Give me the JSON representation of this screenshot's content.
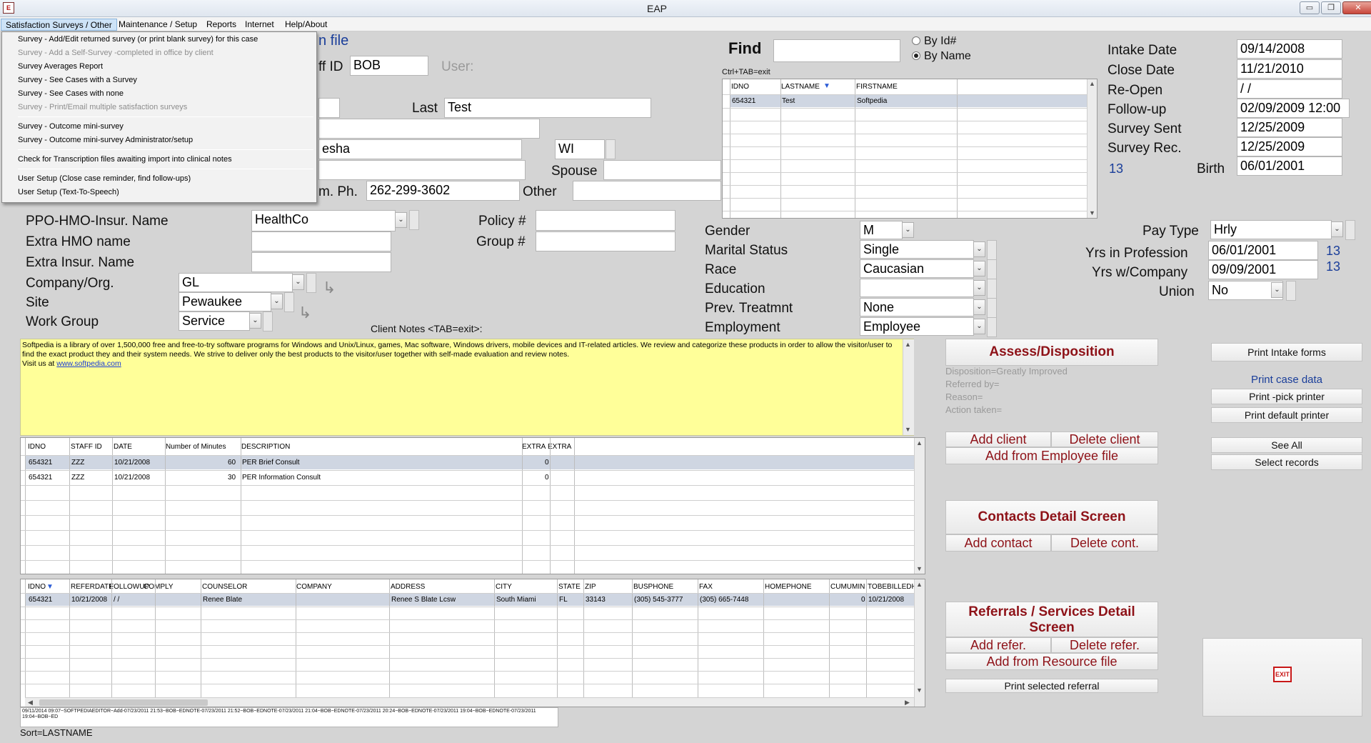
{
  "window": {
    "title": "EAP",
    "minimize": "▭",
    "restore": "❐",
    "close": "✕"
  },
  "menu": {
    "items": [
      "Satisfaction Surveys / Other",
      "Maintenance / Setup",
      "Reports",
      "Internet",
      "Help/About"
    ]
  },
  "dropdown": {
    "items": [
      {
        "label": "Survey - Add/Edit returned survey (or print blank survey) for this case",
        "disabled": false
      },
      {
        "label": "Survey - Add a Self-Survey -completed in office by client",
        "disabled": true
      },
      {
        "label": "Survey Averages Report",
        "disabled": false
      },
      {
        "label": "Survey - See Cases with a Survey",
        "disabled": false
      },
      {
        "label": "Survey - See Cases with none",
        "disabled": false
      },
      {
        "label": "Survey - Print/Email multiple satisfaction surveys",
        "disabled": true
      },
      {
        "label": "Survey - Outcome mini-survey",
        "disabled": false
      },
      {
        "label": "Survey - Outcome mini-survey Administrator/setup",
        "disabled": false
      },
      {
        "label": "Check for Transcription files awaiting import into clinical notes",
        "disabled": false
      },
      {
        "label": "User Setup  (Close case reminder, find follow-ups)",
        "disabled": false
      },
      {
        "label": "User Setup (Text-To-Speech)",
        "disabled": false
      }
    ]
  },
  "header": {
    "file_label": "n file",
    "staff_id_label": "ff ID",
    "staff_id": "BOB",
    "user_label": "User:",
    "last_label": "Last",
    "last_value": "Test",
    "city_partial": "esha",
    "state": "WI",
    "spouse_label": "Spouse",
    "home_phone_label": "m. Ph.",
    "home_phone": "262-299-3602",
    "other_label": "Other"
  },
  "find": {
    "label": "Find",
    "value": "",
    "hint": "Ctrl+TAB=exit",
    "radio_id": "By Id#",
    "radio_name": "By Name",
    "columns": [
      "IDNO",
      "LASTNAME",
      "FIRSTNAME"
    ],
    "sort_icon": "▼",
    "rows": [
      [
        "654321",
        "Test",
        "Softpedia"
      ]
    ]
  },
  "dates": {
    "intake_label": "Intake Date",
    "intake": "09/14/2008",
    "close_label": "Close Date",
    "close": "11/21/2010",
    "reopen_label": "Re-Open",
    "reopen": " /  /",
    "followup_label": "Follow-up",
    "followup": "02/09/2009 12:00",
    "survey_sent_label": "Survey Sent",
    "survey_sent": "12/25/2009",
    "survey_rec_label": "Survey Rec.",
    "survey_rec": "12/25/2009",
    "age": "13",
    "birth_label": "Birth",
    "birth": "06/01/2001"
  },
  "insurance": {
    "ppo_label": "PPO-HMO-Insur. Name",
    "ppo": "HealthCo",
    "extra_hmo_label": "Extra HMO name",
    "extra_hmo": "",
    "extra_ins_label": "Extra Insur. Name",
    "extra_ins": "",
    "policy_label": "Policy #",
    "policy": "",
    "group_label": "Group #",
    "group": ""
  },
  "company": {
    "company_label": "Company/Org.",
    "company": "GL",
    "site_label": "Site",
    "site": "Pewaukee",
    "workgroup_label": "Work Group",
    "workgroup": "Service"
  },
  "demographics": {
    "gender_label": "Gender",
    "gender": "M",
    "marital_label": "Marital Status",
    "marital": "Single",
    "race_label": "Race",
    "race": "Caucasian",
    "education_label": "Education",
    "education": "",
    "prev_label": "Prev. Treatmnt",
    "prev": "None",
    "employment_label": "Employment",
    "employment": "Employee"
  },
  "employment": {
    "pay_type_label": "Pay Type",
    "pay_type": "Hrly",
    "yrs_prof_label": "Yrs in Profession",
    "yrs_prof": "06/01/2001",
    "yrs_prof_num": "13",
    "yrs_comp_label": "Yrs w/Company",
    "yrs_comp": "09/09/2001",
    "yrs_comp_num": "13",
    "union_label": "Union",
    "union": "No"
  },
  "notes": {
    "label": "Client Notes <TAB=exit>:",
    "text": "Softpedia is a library of over 1,500,000 free and free-to-try software programs for Windows and Unix/Linux, games,  Mac software, Windows drivers, mobile devices and IT-related articles. We review and categorize these products in order to allow the visitor/user to find the exact product they and  their system needs.  We strive to deliver only the best products to the visitor/user together with self-made evaluation and review  notes.",
    "visit": "Visit us at ",
    "link": "www.softpedia.com"
  },
  "services": {
    "columns": [
      "IDNO",
      "STAFF ID",
      "DATE",
      "Number of Minutes",
      "DESCRIPTION",
      "EXTRA",
      "EXTRA"
    ],
    "rows": [
      [
        "654321",
        "ZZZ",
        "10/21/2008",
        "60",
        "PER Brief Consult",
        "0"
      ],
      [
        "654321",
        "ZZZ",
        "10/21/2008",
        "30",
        "PER Information Consult",
        "0"
      ]
    ]
  },
  "referrals": {
    "columns": [
      "IDNO",
      "REFERDATE",
      "FOLLOWUP",
      "COMPLY",
      "COUNSELOR",
      "COMPANY",
      "ADDRESS",
      "CITY",
      "STATE",
      "ZIP",
      "BUSPHONE",
      "FAX",
      "HOMEPHONE",
      "CUMUMIN",
      "TOBEBILLEDH"
    ],
    "sort_icon": "▼",
    "rows": [
      [
        "654321",
        "10/21/2008",
        " /  /",
        "",
        "Renee Blate",
        "",
        "Renee S Blate Lcsw",
        "South Miami",
        "FL",
        "33143",
        "(305) 545-3777",
        "(305) 665-7448",
        "",
        "0",
        "10/21/2008"
      ]
    ]
  },
  "log": {
    "text": "09/11/2014 09:07~SOFTPEDIAEDITOR~Add-07/23/2011 21:53~BOB~EDNOTE-07/23/2011 21:52~BOB~EDNOTE-07/23/2011 21:04~BOB~EDNOTE-07/23/2011 20:24~BOB~EDNOTE-07/23/2011 19:04~BOB~EDNOTE-07/23/2011 19:04~BOB~ED",
    "sort": "Sort=LASTNAME"
  },
  "actions": {
    "assess": "Assess/Disposition",
    "disposition": "Disposition=Greatly Improved",
    "referred_by": "Referred by=",
    "reason": "Reason=",
    "action_taken": "Action taken=",
    "add_client": "Add client",
    "delete_client": "Delete client",
    "add_from_employee": "Add from Employee file",
    "contacts_detail": "Contacts Detail Screen",
    "add_contact": "Add contact",
    "delete_contact": "Delete cont.",
    "referrals_detail": "Referrals / Services Detail Screen",
    "add_refer": "Add refer.",
    "delete_refer": "Delete refer.",
    "add_from_resource": "Add from Resource file",
    "print_selected_referral": "Print selected referral"
  },
  "print": {
    "intake_forms": "Print Intake forms",
    "case_data": "Print case data",
    "pick_printer": "Print -pick printer",
    "default_printer": "Print default printer",
    "see_all": "See All",
    "select_records": "Select records"
  },
  "exit": {
    "label": "EXIT"
  },
  "colors": {
    "accent_red": "#8e1218",
    "blue_text": "#1a3e9a",
    "notes_bg": "#ffff99"
  }
}
